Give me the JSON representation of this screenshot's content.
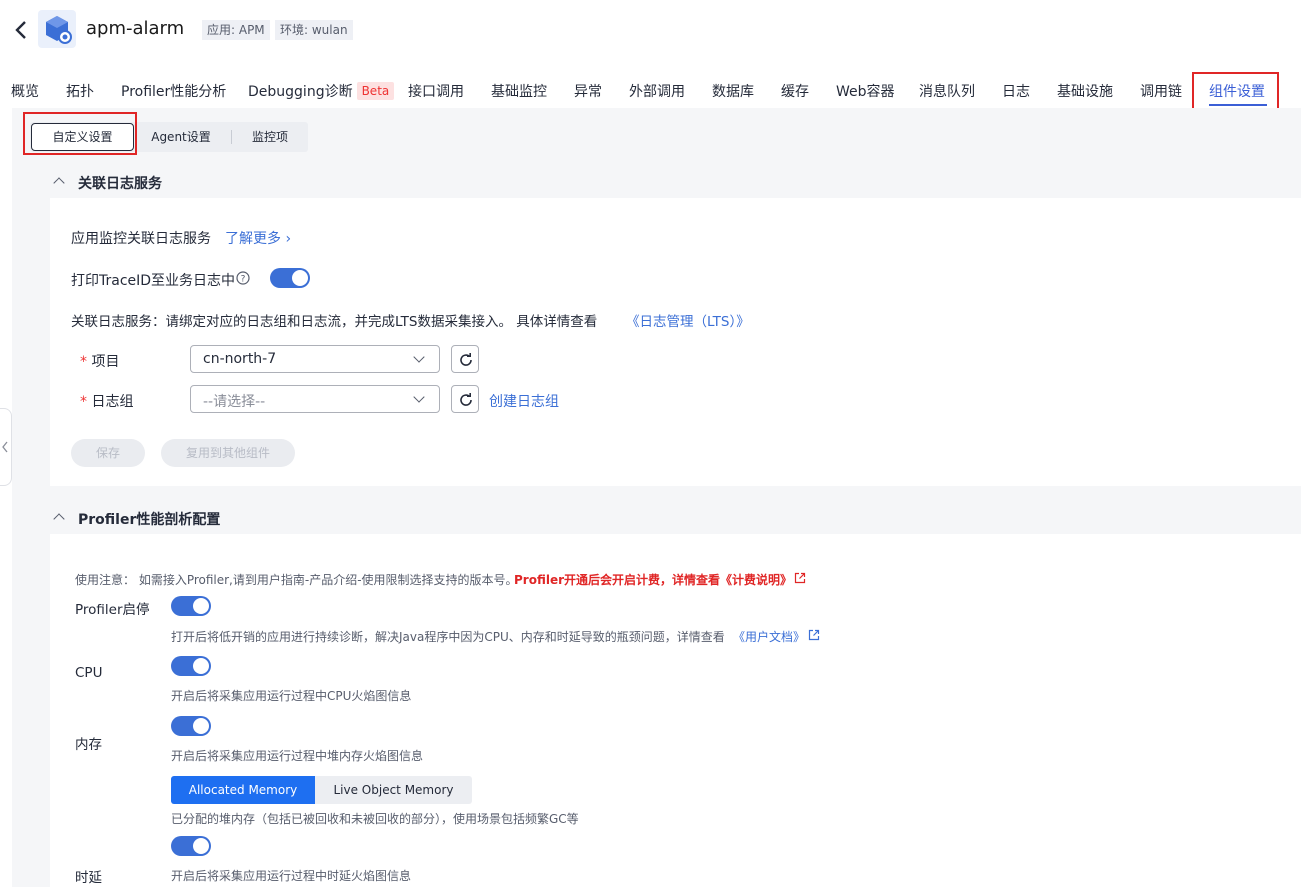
{
  "header": {
    "app_name": "apm-alarm",
    "tag_app": "应用: APM",
    "tag_env": "环境: wulan"
  },
  "tabs": [
    {
      "label": "概览"
    },
    {
      "label": "拓扑"
    },
    {
      "label": "Profiler性能分析"
    },
    {
      "label": "Debugging诊断",
      "badge": "Beta"
    },
    {
      "label": "接口调用"
    },
    {
      "label": "基础监控"
    },
    {
      "label": "异常"
    },
    {
      "label": "外部调用"
    },
    {
      "label": "数据库"
    },
    {
      "label": "缓存"
    },
    {
      "label": "Web容器"
    },
    {
      "label": "消息队列"
    },
    {
      "label": "日志"
    },
    {
      "label": "基础设施"
    },
    {
      "label": "调用链"
    },
    {
      "label": "组件设置",
      "active": true
    }
  ],
  "subtabs": [
    "自定义设置",
    "Agent设置",
    "监控项"
  ],
  "log_section": {
    "title": "关联日志服务",
    "intro": "应用监控关联日志服务",
    "learn_more": "了解更多",
    "trace_label": "打印TraceID至业务日志中",
    "trace_on": true,
    "desc": "关联日志服务：请绑定对应的日志组和日志流，并完成LTS数据采集接入。 具体详情查看",
    "desc_link": "《日志管理（LTS）》",
    "project_label": "项目",
    "project_value": "cn-north-7",
    "loggroup_label": "日志组",
    "loggroup_placeholder": "--请选择--",
    "create_loggroup": "创建日志组",
    "save": "保存",
    "reuse": "复用到其他组件"
  },
  "profiler_section": {
    "title": "Profiler性能剖析配置",
    "notice": "使用注意： 如需接入Profiler,请到用户指南-产品介绍-使用限制选择支持的版本号。",
    "notice_red": "Profiler开通后会开启计费，详情查看《计费说明》",
    "switch_label": "Profiler启停",
    "switch_desc": "打开后将低开销的应用进行持续诊断，解决Java程序中因为CPU、内存和时延导致的瓶颈问题，详情查看",
    "switch_link": "《用户文档》",
    "cpu_label": "CPU",
    "cpu_desc": "开启后将采集应用运行过程中CPU火焰图信息",
    "mem_label": "内存",
    "mem_desc": "开启后将采集应用运行过程中堆内存火焰图信息",
    "mem_options": [
      "Allocated Memory",
      "Live Object Memory"
    ],
    "mem_selected": "Allocated Memory",
    "mem_option_desc": "已分配的堆内存（包括已被回收和未被回收的部分），使用场景包括频繁GC等",
    "latency_label": "时延",
    "latency_desc": "开启后将采集应用运行过程中时延火焰图信息"
  },
  "colors": {
    "accent": "#3b6fd6",
    "highlight_box": "#e02626"
  }
}
